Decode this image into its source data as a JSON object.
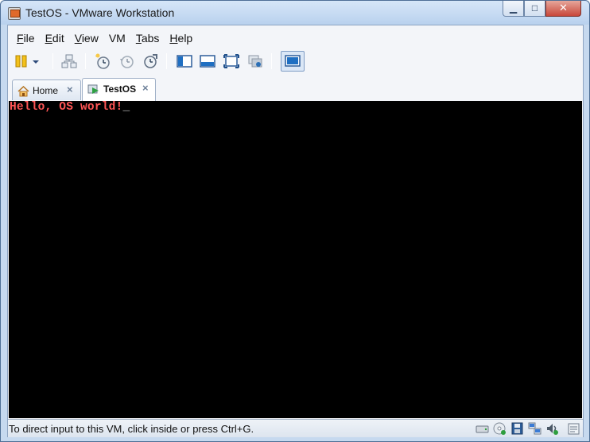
{
  "window": {
    "title": "TestOS - VMware Workstation",
    "caption": {
      "minimize_glyph": "▁",
      "maximize_glyph": "□",
      "close_glyph": "✕"
    }
  },
  "menu": [
    {
      "label": "File",
      "underline": "F",
      "rest": "ile"
    },
    {
      "label": "Edit",
      "underline": "E",
      "rest": "dit"
    },
    {
      "label": "View",
      "underline": "V",
      "rest": "iew"
    },
    {
      "label": "VM",
      "underline": "",
      "rest": "VM"
    },
    {
      "label": "Tabs",
      "underline": "T",
      "rest": "abs"
    },
    {
      "label": "Help",
      "underline": "H",
      "rest": "elp"
    }
  ],
  "toolbar": {
    "icons": [
      "pause-icon",
      "dropdown-arrow-icon",
      "network-icon",
      "snapshot-take-icon",
      "snapshot-revert-icon",
      "snapshot-manager-icon",
      "sidebar-icon",
      "thumbnail-bar-icon",
      "fullscreen-icon",
      "unity-icon",
      "console-view-icon"
    ]
  },
  "tabs": [
    {
      "label": "Home",
      "close": "×",
      "icon": "home-icon",
      "active": false
    },
    {
      "label": "TestOS",
      "close": "×",
      "icon": "vm-running-icon",
      "active": true
    }
  ],
  "console": {
    "text": "Hello, OS world!",
    "cursor": "_",
    "text_color": "#ff5555",
    "background": "#000000"
  },
  "status": {
    "text": "To direct input to this VM, click inside or press Ctrl+G.",
    "icons": [
      "hard-disk-icon",
      "cd-rom-icon",
      "floppy-icon",
      "network-adapter-icon",
      "sound-icon",
      "message-log-icon"
    ]
  },
  "colors": {
    "titlebar": "#c6d9ef",
    "close_button": "#c8473a"
  }
}
